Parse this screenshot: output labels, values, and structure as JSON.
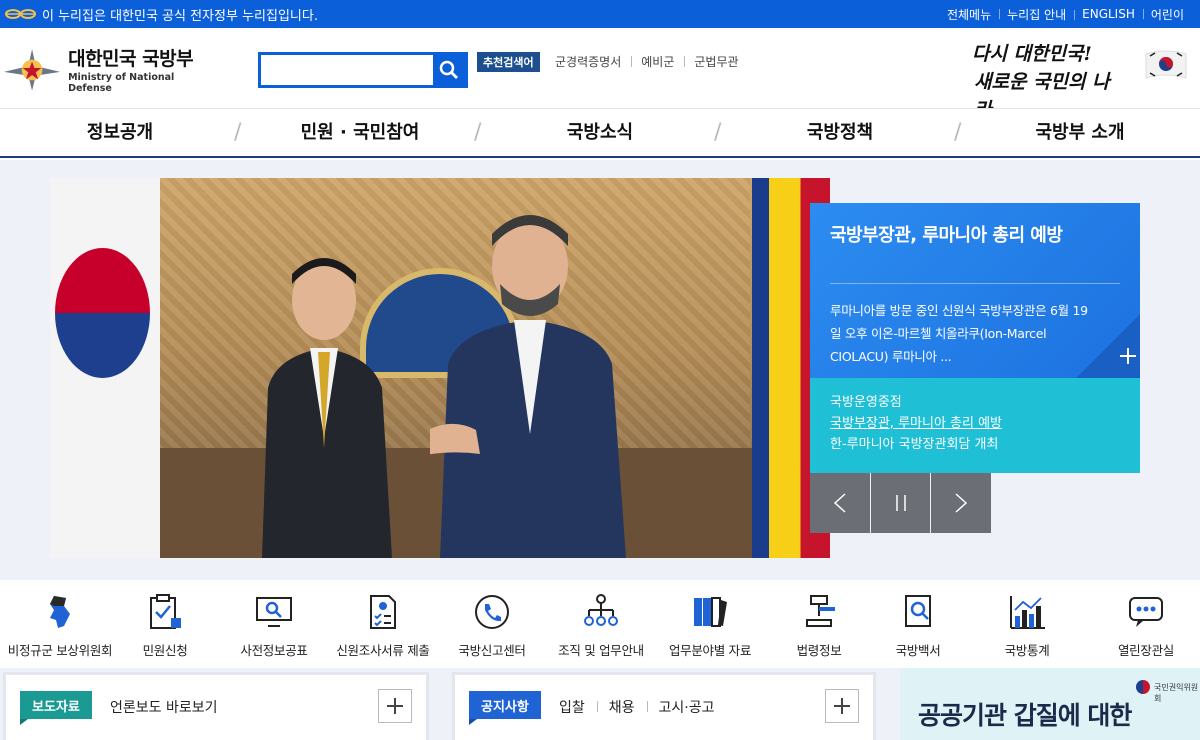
{
  "gov_banner": {
    "text": "이 누리집은 대한민국 공식 전자정부 누리집입니다.",
    "links": [
      "전체메뉴",
      "누리집 안내",
      "ENGLISH",
      "어린이"
    ]
  },
  "header": {
    "logo_ko": "대한민국 국방부",
    "logo_en": "Ministry of National Defense",
    "search_placeholder": "",
    "recommended_label": "추천검색어",
    "recommended": [
      "군경력증명서",
      "예비군",
      "군법무관"
    ],
    "slogan_line1": "다시 대한민국!",
    "slogan_line2": "새로운 국민의 나라"
  },
  "gnb": [
    "정보공개",
    "민원 · 국민참여",
    "국방소식",
    "국방정책",
    "국방부 소개"
  ],
  "visual": {
    "headline": "국방부장관, 루마니아 총리 예방",
    "summary": "루마니아를 방문 중인 신원식 국방부장관은 6월 19일 오후 이온-마르첼 치올라쿠(Ion-Marcel CIOLACU) 루마니아 ...",
    "sub_category": "국방운영중점",
    "sub_items": [
      "국방부장관, 루마니아 총리 예방",
      "한-루마니아 국방장관회담 개최"
    ],
    "controls": [
      "prev",
      "pause",
      "next"
    ]
  },
  "quick_menu": [
    {
      "label": "비정규군 보상위원회",
      "icon": "korea-map-icon"
    },
    {
      "label": "민원신청",
      "icon": "clipboard-check-icon"
    },
    {
      "label": "사전정보공표",
      "icon": "monitor-search-icon"
    },
    {
      "label": "신원조사서류 제출",
      "icon": "document-check-icon"
    },
    {
      "label": "국방신고센터",
      "icon": "phone-icon"
    },
    {
      "label": "조직 및 업무안내",
      "icon": "org-chart-icon"
    },
    {
      "label": "업무분야별 자료",
      "icon": "binders-icon"
    },
    {
      "label": "법령정보",
      "icon": "gavel-icon"
    },
    {
      "label": "국방백서",
      "icon": "book-search-icon"
    },
    {
      "label": "국방통계",
      "icon": "bar-chart-icon"
    },
    {
      "label": "열린장관실",
      "icon": "chat-bubble-icon"
    }
  ],
  "boards": {
    "press": {
      "tag": "보도자료",
      "title": "언론보도 바로보기"
    },
    "notice": {
      "tag": "공지사항",
      "links": [
        "입찰",
        "채용",
        "고시·공고"
      ]
    }
  },
  "banner": {
    "text": "공공기관 갑질에 대한",
    "org": "국민권익위원회"
  },
  "colors": {
    "gov_blue": "#0b5fd8",
    "navy": "#1d3d7a",
    "panel_blue": "#2c8cf0",
    "panel_cyan": "#1fbfd6",
    "press_tag": "#1a9a92",
    "notice_tag": "#1f63d4"
  }
}
